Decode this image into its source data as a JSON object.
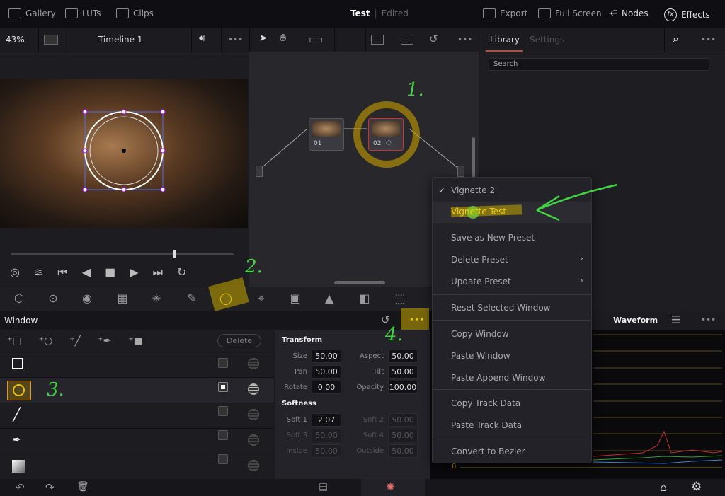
{
  "topbar": {
    "gallery": "Gallery",
    "luts": "LUTs",
    "clips": "Clips",
    "project": "Test",
    "status": "Edited",
    "export": "Export",
    "fullscreen": "Full Screen",
    "nodes": "Nodes",
    "effects": "Effects"
  },
  "toolbar": {
    "zoom": "43%",
    "timeline": "Timeline 1",
    "library_tab": "Library",
    "settings_tab": "Settings"
  },
  "library": {
    "search_placeholder": "Search"
  },
  "nodes": [
    {
      "label": "01"
    },
    {
      "label": "02"
    }
  ],
  "window_panel": {
    "title": "Window",
    "delete": "Delete"
  },
  "transform": {
    "title": "Transform",
    "size_l": "Size",
    "size": "50.00",
    "aspect_l": "Aspect",
    "aspect": "50.00",
    "pan_l": "Pan",
    "pan": "50.00",
    "tilt_l": "Tilt",
    "tilt": "50.00",
    "rotate_l": "Rotate",
    "rotate": "0.00",
    "opacity_l": "Opacity",
    "opacity": "100.00"
  },
  "softness": {
    "title": "Softness",
    "soft1_l": "Soft 1",
    "soft1": "2.07",
    "soft2_l": "Soft 2",
    "soft2": "50.00",
    "soft3_l": "Soft 3",
    "soft3": "50.00",
    "soft4_l": "Soft 4",
    "soft4": "50.00",
    "inside_l": "Inside",
    "inside": "50.00",
    "outside_l": "Outside",
    "outside": "50.00"
  },
  "scope": {
    "title": "Waveform",
    "zero": "0"
  },
  "menu": {
    "items": [
      "Vignette 2",
      "Vignette Test",
      "Save as New Preset",
      "Delete Preset",
      "Update Preset",
      "Reset Selected Window",
      "Copy Window",
      "Paste Window",
      "Paste Append Window",
      "Copy Track Data",
      "Paste Track Data",
      "Convert to Bezier"
    ],
    "checked": "Vignette 2"
  },
  "annotations": [
    "1.",
    "2.",
    "3.",
    "4."
  ],
  "colors": {
    "accent": "#e6c200",
    "annotation": "#41d341",
    "library_underline": "#c0463e"
  }
}
